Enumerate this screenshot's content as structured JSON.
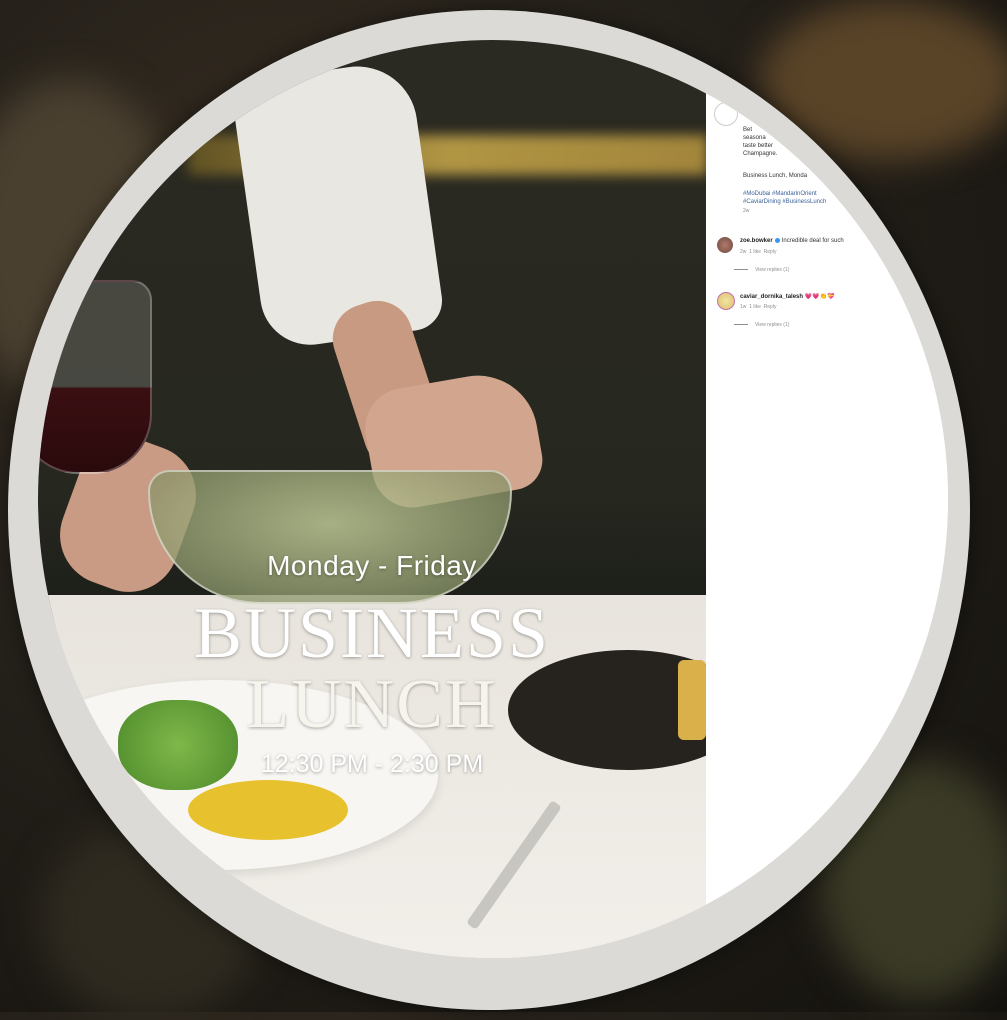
{
  "post_image": {
    "days": "Monday - Friday",
    "title_line1": "BUSINESS",
    "title_line2": "LUNCH",
    "hours": "12:30 PM - 2:30 PM"
  },
  "caption": {
    "line1": "Bet",
    "line2": "seasona",
    "line3": "taste better",
    "line4": "Champagne.",
    "line5": "Business Lunch, Monda",
    "hashtags_line1": "#MoDubai #MandarinOrient",
    "hashtags_line2": "#CaviarDining #BusinessLunch",
    "time": "2w"
  },
  "comments": [
    {
      "username": "zoe.bowker",
      "text": "Incredible deal for such",
      "time": "2w",
      "likes": "1 like",
      "reply": "Reply",
      "view_replies": "View replies (1)"
    },
    {
      "username": "caviar_dornika_talesh",
      "text": "💗💗👏💝",
      "time": "1w",
      "likes": "1 like",
      "reply": "Reply",
      "view_replies": "View replies (1)"
    }
  ],
  "colors": {
    "ring": "#dcdad6",
    "hashtag": "#3b5f97",
    "verified": "#3897f0"
  }
}
